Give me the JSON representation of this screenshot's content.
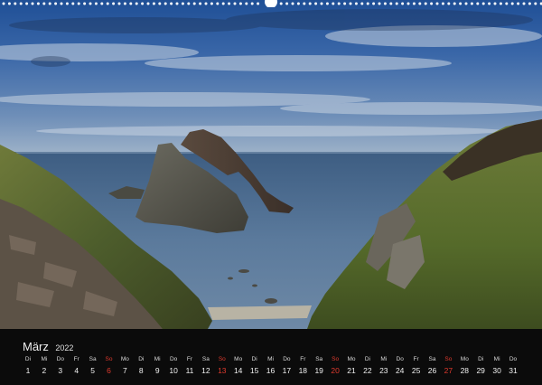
{
  "calendar": {
    "month": "März",
    "year": "2022",
    "sunday_color": "#e03a2e",
    "text_color": "#f0f0f0",
    "strip_color": "#0b0b0b",
    "days": [
      {
        "weekday": "Di",
        "date": "1"
      },
      {
        "weekday": "Mi",
        "date": "2"
      },
      {
        "weekday": "Do",
        "date": "3"
      },
      {
        "weekday": "Fr",
        "date": "4"
      },
      {
        "weekday": "Sa",
        "date": "5"
      },
      {
        "weekday": "So",
        "date": "6",
        "sunday": true
      },
      {
        "weekday": "Mo",
        "date": "7"
      },
      {
        "weekday": "Di",
        "date": "8"
      },
      {
        "weekday": "Mi",
        "date": "9"
      },
      {
        "weekday": "Do",
        "date": "10"
      },
      {
        "weekday": "Fr",
        "date": "11"
      },
      {
        "weekday": "Sa",
        "date": "12"
      },
      {
        "weekday": "So",
        "date": "13",
        "sunday": true
      },
      {
        "weekday": "Mo",
        "date": "14"
      },
      {
        "weekday": "Di",
        "date": "15"
      },
      {
        "weekday": "Mi",
        "date": "16"
      },
      {
        "weekday": "Do",
        "date": "17"
      },
      {
        "weekday": "Fr",
        "date": "18"
      },
      {
        "weekday": "Sa",
        "date": "19"
      },
      {
        "weekday": "So",
        "date": "20",
        "sunday": true
      },
      {
        "weekday": "Mo",
        "date": "21"
      },
      {
        "weekday": "Di",
        "date": "22"
      },
      {
        "weekday": "Mi",
        "date": "23"
      },
      {
        "weekday": "Do",
        "date": "24"
      },
      {
        "weekday": "Fr",
        "date": "25"
      },
      {
        "weekday": "Sa",
        "date": "26"
      },
      {
        "weekday": "So",
        "date": "27",
        "sunday": true
      },
      {
        "weekday": "Mo",
        "date": "28"
      },
      {
        "weekday": "Di",
        "date": "29"
      },
      {
        "weekday": "Mi",
        "date": "30"
      },
      {
        "weekday": "Do",
        "date": "31"
      }
    ]
  }
}
